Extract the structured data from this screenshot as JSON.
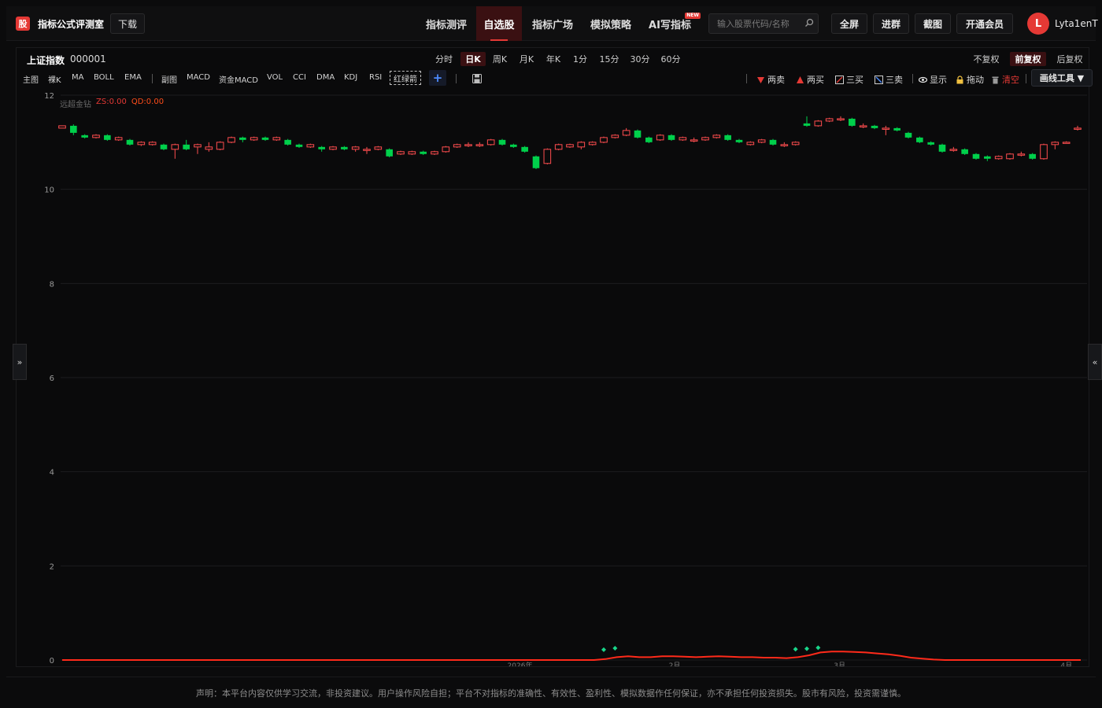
{
  "app": {
    "logo": "股",
    "title": "指标公式评测室",
    "download": "下载"
  },
  "nav": {
    "tabs": [
      {
        "label": "指标测评",
        "active": false
      },
      {
        "label": "自选股",
        "active": true
      },
      {
        "label": "指标广场",
        "active": false
      },
      {
        "label": "模拟策略",
        "active": false
      },
      {
        "label": "AI写指标",
        "active": false,
        "badge": "NEW"
      }
    ],
    "search_placeholder": "输入股票代码/名称",
    "search_icon": "search-icon",
    "buttons": [
      "全屏",
      "进群",
      "截图",
      "开通会员"
    ],
    "avatar_letter": "L",
    "username": "Lyta1enT"
  },
  "stock": {
    "name": "上证指数",
    "code": "000001"
  },
  "periods": [
    {
      "label": "分时",
      "active": false
    },
    {
      "label": "日K",
      "active": true
    },
    {
      "label": "周K",
      "active": false
    },
    {
      "label": "月K",
      "active": false
    },
    {
      "label": "年K",
      "active": false
    },
    {
      "label": "1分",
      "active": false
    },
    {
      "label": "15分",
      "active": false
    },
    {
      "label": "30分",
      "active": false
    },
    {
      "label": "60分",
      "active": false
    }
  ],
  "adjustments": [
    {
      "label": "不复权",
      "active": false
    },
    {
      "label": "前复权",
      "active": true
    },
    {
      "label": "后复权",
      "active": false
    }
  ],
  "indicators_main": [
    "主图",
    "裸K",
    "MA",
    "BOLL",
    "EMA"
  ],
  "indicators_sub": [
    "副图",
    "MACD",
    "资金MACD",
    "VOL",
    "CCI",
    "DMA",
    "KDJ",
    "RSI"
  ],
  "indicator_custom": "红绿箭",
  "plus_label": "+",
  "drawing_tools": [
    {
      "label": "两卖",
      "icon": "triangle-down-icon",
      "color": "#e53935"
    },
    {
      "label": "两买",
      "icon": "triangle-up-icon",
      "color": "#e53935"
    },
    {
      "label": "三买",
      "icon": "line-up-icon",
      "color": "#dcdcdc"
    },
    {
      "label": "三卖",
      "icon": "line-down-icon",
      "color": "#dcdcdc"
    },
    {
      "label": "显示",
      "icon": "eye-icon",
      "color": "#dcdcdc"
    },
    {
      "label": "拖动",
      "icon": "lock-icon",
      "color": "#dcdcdc"
    },
    {
      "label": "清空",
      "icon": "trash-icon",
      "color": "#e53935"
    }
  ],
  "draw_tool_button": "画线工具 ▼",
  "legend": {
    "name": "远超金钻",
    "zs": "ZS:0.00",
    "qd": "QD:0.00"
  },
  "colors": {
    "up": "#ff4d4f",
    "down": "#00d04b",
    "accent": "#e53935",
    "line": "#ff2a1a",
    "bg": "#0a0a0b"
  },
  "chart_data": {
    "type": "candlestick",
    "y_ticks": [
      0,
      2,
      4,
      6,
      8,
      10,
      12
    ],
    "ylim": [
      0,
      12
    ],
    "x_ticks": [
      "2026年",
      "2月",
      "3月",
      "4月"
    ],
    "candles": [
      [
        11.3,
        11.35,
        11.3,
        11.3
      ],
      [
        11.35,
        11.2,
        11.15,
        11.38
      ],
      [
        11.15,
        11.1,
        11.08,
        11.17
      ],
      [
        11.1,
        11.15,
        11.08,
        11.17
      ],
      [
        11.15,
        11.05,
        11.03,
        11.17
      ],
      [
        11.05,
        11.1,
        11.03,
        11.12
      ],
      [
        11.05,
        10.95,
        10.93,
        11.07
      ],
      [
        10.95,
        11.0,
        10.92,
        11.02
      ],
      [
        10.95,
        11.0,
        10.93,
        11.02
      ],
      [
        10.95,
        10.85,
        10.83,
        10.97
      ],
      [
        10.85,
        10.95,
        10.65,
        10.97
      ],
      [
        10.95,
        10.85,
        10.83,
        11.05
      ],
      [
        10.9,
        10.95,
        10.75,
        10.97
      ],
      [
        10.85,
        10.9,
        10.8,
        11.0
      ],
      [
        10.85,
        11.0,
        10.83,
        11.02
      ],
      [
        11.0,
        11.1,
        10.98,
        11.12
      ],
      [
        11.1,
        11.05,
        11.0,
        11.12
      ],
      [
        11.05,
        11.1,
        11.03,
        11.12
      ],
      [
        11.1,
        11.05,
        11.03,
        11.12
      ],
      [
        11.05,
        11.1,
        11.03,
        11.12
      ],
      [
        11.05,
        10.95,
        10.93,
        11.07
      ],
      [
        10.95,
        10.9,
        10.88,
        10.97
      ],
      [
        10.9,
        10.95,
        10.88,
        10.97
      ],
      [
        10.9,
        10.85,
        10.8,
        10.92
      ],
      [
        10.85,
        10.9,
        10.83,
        10.92
      ],
      [
        10.9,
        10.85,
        10.83,
        10.92
      ],
      [
        10.85,
        10.9,
        10.8,
        10.92
      ],
      [
        10.85,
        10.85,
        10.75,
        10.9
      ],
      [
        10.85,
        10.9,
        10.83,
        10.92
      ],
      [
        10.85,
        10.7,
        10.68,
        10.87
      ],
      [
        10.75,
        10.8,
        10.73,
        10.82
      ],
      [
        10.75,
        10.8,
        10.73,
        10.82
      ],
      [
        10.8,
        10.75,
        10.73,
        10.82
      ],
      [
        10.75,
        10.8,
        10.73,
        10.82
      ],
      [
        10.8,
        10.9,
        10.78,
        10.92
      ],
      [
        10.9,
        10.95,
        10.88,
        10.97
      ],
      [
        10.95,
        10.95,
        10.9,
        11.0
      ],
      [
        10.95,
        10.95,
        10.9,
        11.0
      ],
      [
        10.95,
        11.05,
        10.93,
        11.07
      ],
      [
        11.05,
        10.95,
        10.93,
        11.07
      ],
      [
        10.95,
        10.9,
        10.88,
        10.97
      ],
      [
        10.9,
        10.8,
        10.78,
        10.92
      ],
      [
        10.7,
        10.45,
        10.43,
        10.72
      ],
      [
        10.55,
        10.85,
        10.53,
        10.87
      ],
      [
        10.85,
        10.95,
        10.83,
        10.97
      ],
      [
        10.9,
        10.95,
        10.88,
        10.97
      ],
      [
        10.9,
        11.0,
        10.85,
        11.02
      ],
      [
        10.95,
        11.0,
        10.93,
        11.02
      ],
      [
        11.0,
        11.1,
        10.98,
        11.12
      ],
      [
        11.1,
        11.15,
        11.08,
        11.17
      ],
      [
        11.15,
        11.25,
        11.13,
        11.3
      ],
      [
        11.25,
        11.1,
        11.08,
        11.27
      ],
      [
        11.1,
        11.0,
        10.98,
        11.12
      ],
      [
        11.05,
        11.15,
        11.03,
        11.17
      ],
      [
        11.15,
        11.05,
        11.03,
        11.17
      ],
      [
        11.05,
        11.1,
        11.03,
        11.12
      ],
      [
        11.05,
        11.05,
        11.0,
        11.1
      ],
      [
        11.05,
        11.1,
        11.03,
        11.12
      ],
      [
        11.1,
        11.15,
        11.08,
        11.17
      ],
      [
        11.15,
        11.05,
        11.03,
        11.17
      ],
      [
        11.05,
        11.0,
        10.98,
        11.07
      ],
      [
        10.95,
        11.0,
        10.93,
        11.02
      ],
      [
        11.0,
        11.05,
        10.98,
        11.07
      ],
      [
        11.05,
        10.95,
        10.93,
        11.07
      ],
      [
        10.95,
        10.95,
        10.9,
        11.0
      ],
      [
        10.95,
        11.0,
        10.93,
        11.02
      ],
      [
        11.4,
        11.35,
        11.33,
        11.55
      ],
      [
        11.35,
        11.45,
        11.33,
        11.47
      ],
      [
        11.45,
        11.5,
        11.43,
        11.52
      ],
      [
        11.5,
        11.5,
        11.45,
        11.55
      ],
      [
        11.5,
        11.35,
        11.33,
        11.52
      ],
      [
        11.35,
        11.35,
        11.3,
        11.4
      ],
      [
        11.35,
        11.3,
        11.28,
        11.37
      ],
      [
        11.3,
        11.3,
        11.15,
        11.35
      ],
      [
        11.3,
        11.25,
        11.23,
        11.32
      ],
      [
        11.2,
        11.1,
        11.08,
        11.22
      ],
      [
        11.1,
        11.0,
        10.98,
        11.12
      ],
      [
        11.0,
        10.95,
        10.93,
        11.02
      ],
      [
        10.95,
        10.8,
        10.78,
        10.97
      ],
      [
        10.85,
        10.85,
        10.8,
        10.9
      ],
      [
        10.85,
        10.75,
        10.73,
        10.87
      ],
      [
        10.75,
        10.65,
        10.63,
        10.77
      ],
      [
        10.7,
        10.65,
        10.6,
        10.72
      ],
      [
        10.65,
        10.7,
        10.63,
        10.72
      ],
      [
        10.65,
        10.75,
        10.63,
        10.77
      ],
      [
        10.75,
        10.75,
        10.7,
        10.8
      ],
      [
        10.75,
        10.65,
        10.63,
        10.77
      ],
      [
        10.65,
        10.95,
        10.63,
        10.97
      ],
      [
        10.95,
        11.0,
        10.85,
        11.02
      ],
      [
        11.0,
        11.0,
        10.98,
        11.02
      ],
      [
        11.3,
        11.3,
        11.25,
        11.35
      ]
    ],
    "indicator_line": {
      "name": "QD",
      "values": [
        0.0,
        0.0,
        0.0,
        0.0,
        0.0,
        0.0,
        0.0,
        0.0,
        0.0,
        0.0,
        0.0,
        0.0,
        0.0,
        0.0,
        0.0,
        0.0,
        0.0,
        0.0,
        0.0,
        0.0,
        0.0,
        0.0,
        0.0,
        0.0,
        0.0,
        0.0,
        0.0,
        0.0,
        0.0,
        0.0,
        0.0,
        0.0,
        0.0,
        0.0,
        0.0,
        0.0,
        0.0,
        0.0,
        0.0,
        0.0,
        0.0,
        0.0,
        0.0,
        0.0,
        0.0,
        0.0,
        0.0,
        0.0,
        0.02,
        0.06,
        0.08,
        0.06,
        0.06,
        0.08,
        0.08,
        0.07,
        0.06,
        0.07,
        0.08,
        0.07,
        0.06,
        0.06,
        0.05,
        0.05,
        0.04,
        0.06,
        0.1,
        0.16,
        0.18,
        0.18,
        0.17,
        0.16,
        0.14,
        0.12,
        0.09,
        0.05,
        0.03,
        0.01,
        0.0,
        0.0,
        0.0,
        0.0,
        0.0,
        0.0,
        0.0,
        0.0,
        0.0,
        0.0,
        0.0,
        0.0,
        0.0
      ]
    },
    "signal_points": [
      {
        "index": 48,
        "value": 0.12
      },
      {
        "index": 49,
        "value": 0.15
      },
      {
        "index": 65,
        "value": 0.13
      },
      {
        "index": 66,
        "value": 0.14
      },
      {
        "index": 67,
        "value": 0.16
      }
    ]
  },
  "footer": "声明：本平台内容仅供学习交流，非投资建议。用户操作风险自担；平台不对指标的准确性、有效性、盈利性、模拟数据作任何保证，亦不承担任何投资损失。股市有风险，投资需谨慎。"
}
